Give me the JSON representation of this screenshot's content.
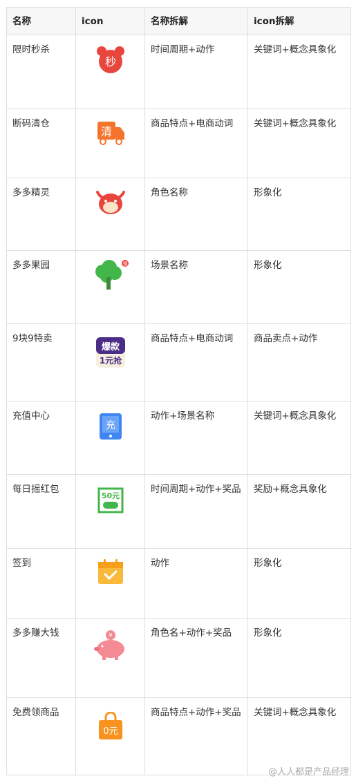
{
  "header": {
    "col1": "名称",
    "col2": "icon",
    "col3": "名称拆解",
    "col4": "icon拆解"
  },
  "rows": [
    {
      "name": "限时秒杀",
      "icon": "alarm-clock-icon",
      "glyph": "秒",
      "name_breakdown": "时间周期+动作",
      "icon_breakdown": "关键词+概念具象化"
    },
    {
      "name": "断码清仓",
      "icon": "delivery-truck-icon",
      "glyph": "清",
      "name_breakdown": "商品特点+电商动词",
      "icon_breakdown": "关键词+概念具象化"
    },
    {
      "name": "多多精灵",
      "icon": "cow-sprite-icon",
      "name_breakdown": "角色名称",
      "icon_breakdown": "形象化"
    },
    {
      "name": "多多果园",
      "icon": "tree-icon",
      "glyph": "领",
      "name_breakdown": "场景名称",
      "icon_breakdown": "形象化"
    },
    {
      "name": "9块9特卖",
      "icon": "hot-deal-icon",
      "glyph_top": "爆款",
      "glyph_bottom": "1元抢",
      "name_breakdown": "商品特点+电商动词",
      "icon_breakdown": "商品卖点+动作"
    },
    {
      "name": "充值中心",
      "icon": "tablet-recharge-icon",
      "glyph": "充",
      "name_breakdown": "动作+场景名称",
      "icon_breakdown": "关键词+概念具象化"
    },
    {
      "name": "每日摇红包",
      "icon": "cash-coupon-icon",
      "glyph": "50元",
      "name_breakdown": "时间周期+动作+奖品",
      "icon_breakdown": "奖励+概念具象化"
    },
    {
      "name": "签到",
      "icon": "calendar-check-icon",
      "name_breakdown": "动作",
      "icon_breakdown": "形象化"
    },
    {
      "name": "多多赚大钱",
      "icon": "piggy-bank-icon",
      "glyph": "¥",
      "name_breakdown": "角色名+动作+奖品",
      "icon_breakdown": "形象化"
    },
    {
      "name": "免费领商品",
      "icon": "shopping-bag-icon",
      "glyph": "0元",
      "name_breakdown": "商品特点+动作+奖品",
      "icon_breakdown": "关键词+概念具象化"
    }
  ],
  "watermark": "@人人都是产品经理",
  "colors": {
    "red": "#e8453c",
    "orange": "#f5742d",
    "green": "#43b649",
    "blue": "#3f86f2",
    "yellow": "#f9b93a",
    "pink": "#f48a94",
    "bag": "#f7931e",
    "purple": "#4b2c86"
  }
}
